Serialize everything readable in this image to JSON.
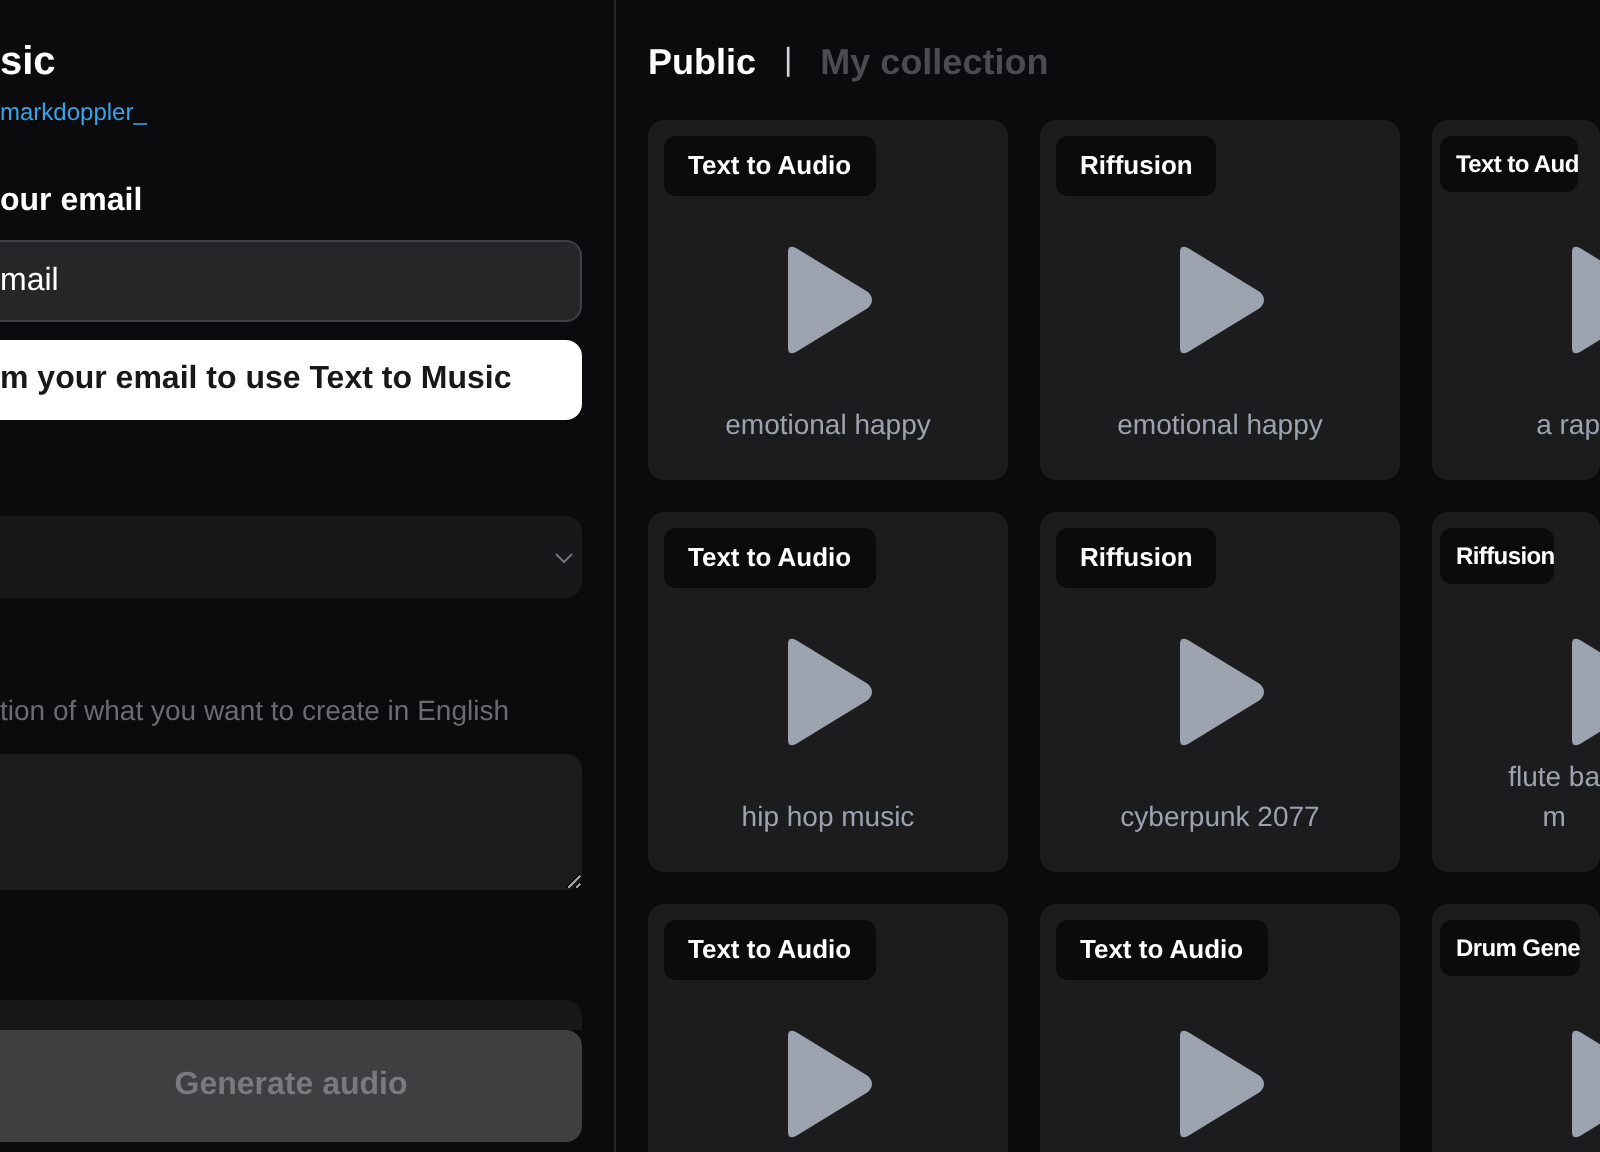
{
  "sidebar": {
    "title": "sic",
    "author_link": "markdoppler_",
    "email_label": "our email",
    "email_field": {
      "value": "mail"
    },
    "confirm_button": "m your email to use Text to Music",
    "model_select": {
      "expanded": false
    },
    "prompt_hint": "tion of what you want to create in English",
    "generate_button": {
      "label": "Generate audio",
      "disabled": true
    }
  },
  "tabs": [
    {
      "label": "Public",
      "selected": true
    },
    {
      "label": "My collection",
      "selected": false
    }
  ],
  "tab_separator": "|",
  "cards": [
    {
      "badge": "Text to Audio",
      "title": "emotional happy"
    },
    {
      "badge": "Riffusion",
      "title": "emotional happy"
    },
    {
      "badge": "Text to Aud",
      "title": "a rap"
    },
    {
      "badge": "Text to Audio",
      "title": "hip hop music"
    },
    {
      "badge": "Riffusion",
      "title": "cyberpunk 2077"
    },
    {
      "badge": "Riffusion",
      "title": "flute ba\nm"
    },
    {
      "badge": "Text to Audio"
    },
    {
      "badge": "Text to Audio"
    },
    {
      "badge": "Drum Gene"
    }
  ]
}
